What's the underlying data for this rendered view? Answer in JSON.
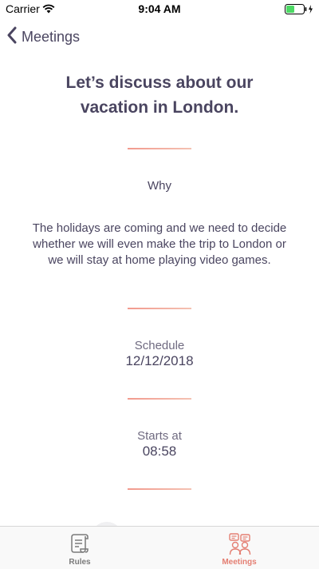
{
  "status_bar": {
    "carrier": "Carrier",
    "time": "9:04 AM"
  },
  "nav": {
    "back_label": "Meetings",
    "back_icon": "chevron-left-icon"
  },
  "meeting": {
    "title": "Let’s discuss about our vacation in London.",
    "why_label": "Why",
    "why_text": "The holidays are coming and we need to decide whether we will even make the trip to London or we will stay at home playing video games.",
    "schedule_label": "Schedule",
    "schedule_value": "12/12/2018",
    "starts_label": "Starts at",
    "starts_value": "08:58"
  },
  "tabs": [
    {
      "label": "Rules",
      "icon": "scroll-document-icon",
      "selected": false
    },
    {
      "label": "Meetings",
      "icon": "people-chat-icon",
      "selected": true
    }
  ],
  "colors": {
    "text": "#4a4560",
    "accent": "#e47f73",
    "divider_start": "#f29a8e",
    "divider_end": "#f4c2b3",
    "battery": "#4cd964"
  }
}
